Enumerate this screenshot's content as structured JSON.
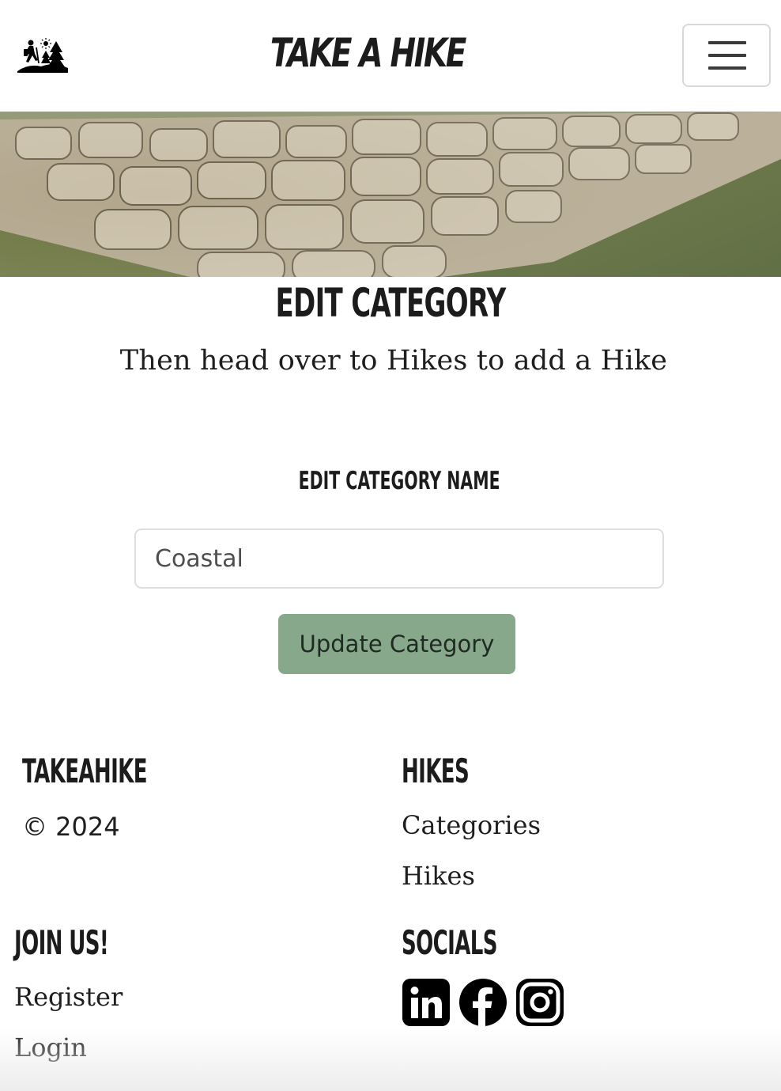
{
  "navbar": {
    "brand": "TAKE A HIKE",
    "logo_icon": "hiker-trees-logo-icon",
    "toggler_icon": "hamburger-menu-icon"
  },
  "hero": {
    "image": "stone-wall-grass-banner"
  },
  "main": {
    "title": "EDIT CATEGORY",
    "subtitle": "Then head over to Hikes to add a Hike",
    "field_label": "EDIT CATEGORY NAME",
    "category_name_value": "Coastal",
    "update_button": "Update Category",
    "button_color": "#88a88c"
  },
  "footer": {
    "brand_heading": "TAKEAHIKE",
    "copyright": "© 2024",
    "hikes_heading": "HIKES",
    "hikes_links": [
      "Categories",
      "Hikes"
    ],
    "join_heading": "JOIN US!",
    "join_links": [
      "Register",
      "Login"
    ],
    "socials_heading": "SOCIALS",
    "social_icons": [
      "linkedin-icon",
      "facebook-icon",
      "instagram-icon"
    ]
  }
}
